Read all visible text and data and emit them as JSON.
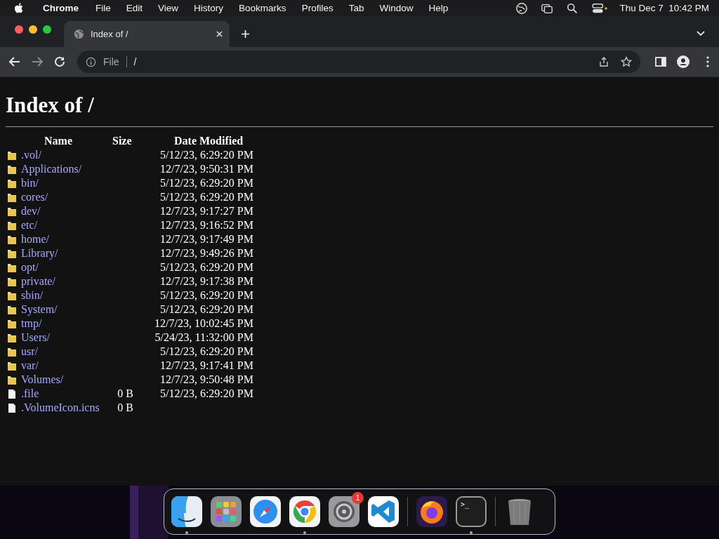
{
  "menubar": {
    "app": "Chrome",
    "items": [
      "File",
      "Edit",
      "View",
      "History",
      "Bookmarks",
      "Profiles",
      "Tab",
      "Window",
      "Help"
    ],
    "clock": "Thu Dec 7  10:42 PM"
  },
  "tabs": [
    {
      "title": "Index of /",
      "selected": true
    }
  ],
  "address": {
    "scheme": "File",
    "url": "/"
  },
  "page": {
    "heading": "Index of /",
    "columns": [
      "Name",
      "Size",
      "Date Modified"
    ],
    "rows": [
      {
        "kind": "folder",
        "name": ".vol/",
        "date": "5/12/23, 6:29:20 PM"
      },
      {
        "kind": "folder",
        "name": "Applications/",
        "date": "12/7/23, 9:50:31 PM"
      },
      {
        "kind": "folder",
        "name": "bin/",
        "date": "5/12/23, 6:29:20 PM"
      },
      {
        "kind": "folder",
        "name": "cores/",
        "date": "5/12/23, 6:29:20 PM"
      },
      {
        "kind": "folder",
        "name": "dev/",
        "date": "12/7/23, 9:17:27 PM"
      },
      {
        "kind": "folder",
        "name": "etc/",
        "date": "12/7/23, 9:16:52 PM"
      },
      {
        "kind": "folder",
        "name": "home/",
        "date": "12/7/23, 9:17:49 PM"
      },
      {
        "kind": "folder",
        "name": "Library/",
        "date": "12/7/23, 9:49:26 PM"
      },
      {
        "kind": "folder",
        "name": "opt/",
        "date": "5/12/23, 6:29:20 PM"
      },
      {
        "kind": "folder",
        "name": "private/",
        "date": "12/7/23, 9:17:38 PM"
      },
      {
        "kind": "folder",
        "name": "sbin/",
        "date": "5/12/23, 6:29:20 PM"
      },
      {
        "kind": "folder",
        "name": "System/",
        "date": "5/12/23, 6:29:20 PM"
      },
      {
        "kind": "folder",
        "name": "tmp/",
        "date": "12/7/23, 10:02:45 PM"
      },
      {
        "kind": "folder",
        "name": "Users/",
        "date": "5/24/23, 11:32:00 PM"
      },
      {
        "kind": "folder",
        "name": "usr/",
        "date": "5/12/23, 6:29:20 PM"
      },
      {
        "kind": "folder",
        "name": "var/",
        "date": "12/7/23, 9:17:41 PM"
      },
      {
        "kind": "folder",
        "name": "Volumes/",
        "date": "12/7/23, 9:50:48 PM"
      },
      {
        "kind": "file",
        "name": ".file",
        "size": "0 B",
        "date": "5/12/23, 6:29:20 PM"
      },
      {
        "kind": "file",
        "name": ".VolumeIcon.icns",
        "size": "0 B"
      }
    ]
  },
  "dock": [
    {
      "kind": "finder",
      "running": true
    },
    {
      "kind": "launchpad",
      "running": false
    },
    {
      "kind": "safari",
      "running": false
    },
    {
      "kind": "chrome",
      "running": true
    },
    {
      "kind": "settings",
      "running": false,
      "badge": "1"
    },
    {
      "kind": "vscode",
      "running": false
    },
    {
      "kind": "separator"
    },
    {
      "kind": "firefox",
      "running": false
    },
    {
      "kind": "terminal",
      "running": true,
      "glyph": ">_"
    },
    {
      "kind": "separator"
    },
    {
      "kind": "trash",
      "running": false
    }
  ]
}
